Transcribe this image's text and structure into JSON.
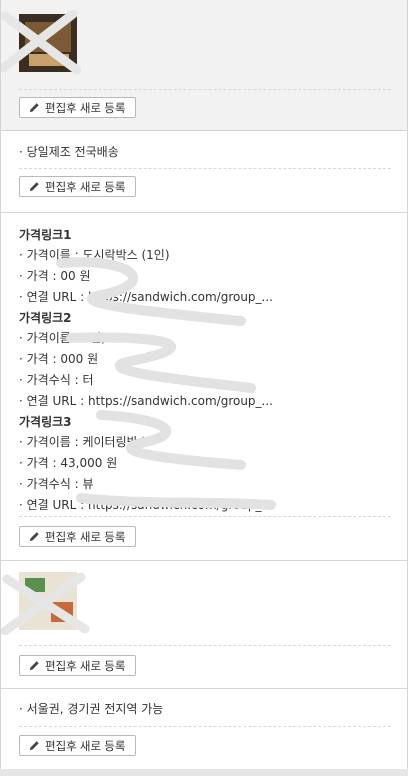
{
  "edit_button_label": "편집후 새로 등록",
  "sections": {
    "delivery": {
      "text": "· 당일제조 전국배송"
    },
    "price_links": {
      "link1": {
        "title": "가격링크1",
        "name": "· 가격이름 : ",
        "name_visible": "도시락박스 (1인)",
        "price": "· 가격 : ",
        "price_visible": "00 원",
        "url": "· 연결 URL : ",
        "url_visible": "https://sandwich.com/group_..."
      },
      "link2": {
        "title": "가격링크2",
        "name": "· 가격이름 : ",
        "name_visible": "1인)",
        "price": "· 가격 : ",
        "price_visible": "000 원",
        "formula": "· 가격수식 : ",
        "formula_visible": "터",
        "url": "· 연결 URL : ",
        "url_visible": "https://sandwich.com/group_..."
      },
      "link3": {
        "title": "가격링크3",
        "name": "· 가격이름 : ",
        "name_visible": "케이터링박스",
        "price": "· 가격 : ",
        "price_visible": "43,000 원",
        "formula": "· 가격수식 : ",
        "formula_visible": "뷰",
        "url": "· 연결 URL : ",
        "url_visible": "https://sandwich.com/group_..."
      }
    },
    "area": {
      "text": "· 서울권, 경기권 전지역 가능"
    }
  }
}
